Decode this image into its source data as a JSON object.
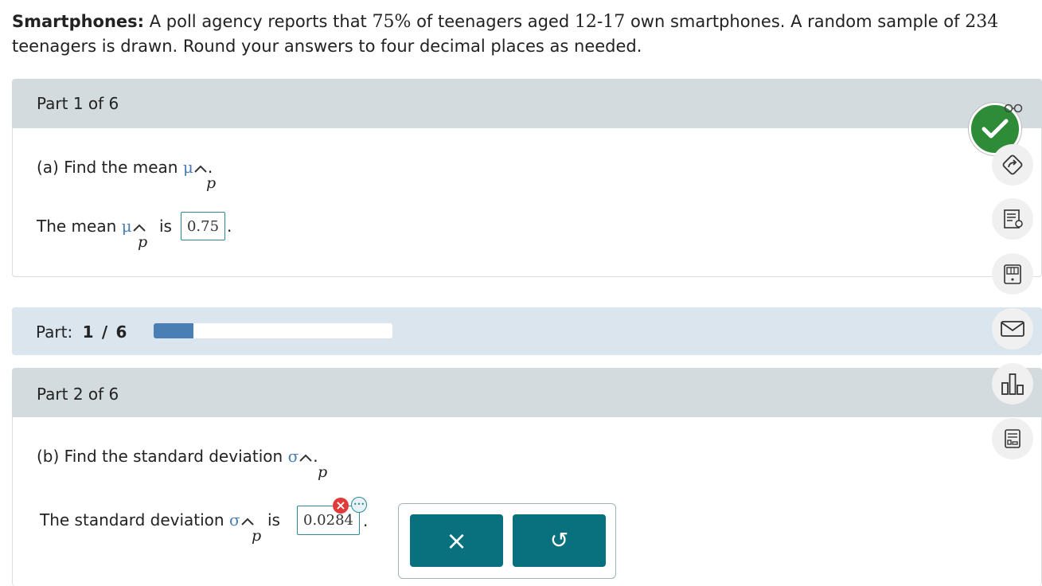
{
  "problem": {
    "title": "Smartphones:",
    "text_before_pct": " A poll agency reports that ",
    "pct": "75%",
    "text_mid": " of teenagers aged ",
    "age_range": "12-17",
    "text_after_age": " own smartphones. A random sample of ",
    "sample_size": "234",
    "line2": "teenagers is drawn. Round your answers to four decimal places as needed."
  },
  "part1": {
    "header": "Part 1 of 6",
    "question_prefix": "(a) Find the mean ",
    "symbol": "μ",
    "sub": "p",
    "period": ".",
    "answer_prefix": "The mean ",
    "answer_is": "is",
    "answer_value": "0.75"
  },
  "progress": {
    "label": "Part:",
    "current": "1",
    "sep": "/",
    "total": "6",
    "fraction": 0.1667
  },
  "part2": {
    "header": "Part 2 of 6",
    "question_prefix": "(b) Find the standard deviation ",
    "symbol": "σ",
    "sub": "p",
    "period": ".",
    "answer_prefix": "The standard deviation ",
    "answer_is": "is",
    "answer_value": "0.0284",
    "incorrect_badge": "×",
    "more_badge": "•••"
  },
  "popup": {
    "clear_icon": "×",
    "undo_icon": "↺"
  },
  "rail": {
    "icons": [
      "check-icon",
      "glasses-icon",
      "redo-icon",
      "explanation-icon",
      "calculator-icon",
      "mail-icon",
      "chart-icon",
      "data-icon"
    ]
  },
  "colors": {
    "header_bg": "#d4dbde",
    "progress_bg": "#dbe5ee",
    "progress_fill": "#4a7fb5",
    "teal_button": "#09707e",
    "check_green": "#2e8b37",
    "error_red": "#e03a3a"
  }
}
